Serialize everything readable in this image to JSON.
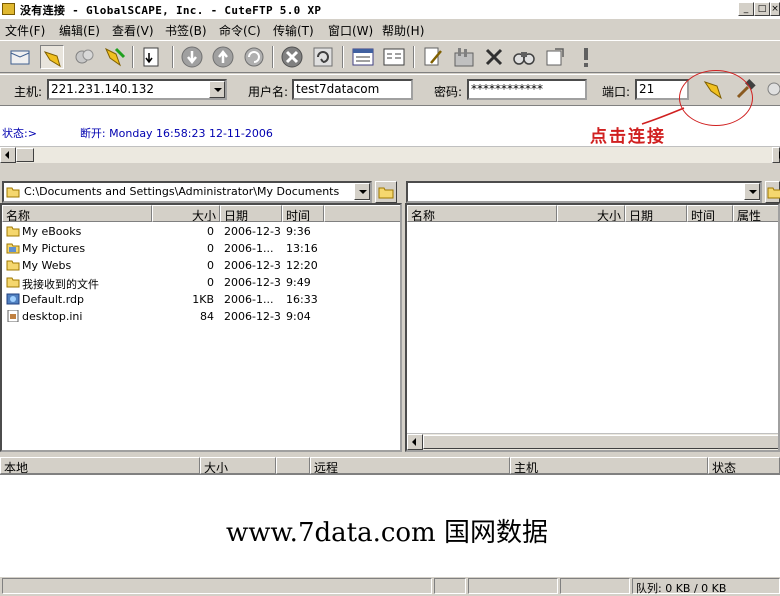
{
  "window": {
    "title": "没有连接 - GlobalSCAPE, Inc. - CuteFTP 5.0 XP",
    "minimize_glyph": "_",
    "maximize_glyph": "□",
    "close_glyph": "×"
  },
  "menu": [
    "文件(F)",
    "编辑(E)",
    "查看(V)",
    "书签(B)",
    "命令(C)",
    "传输(T)",
    "窗口(W)",
    "帮助(H)"
  ],
  "toolbar": {
    "icons": [
      "site-manager-icon",
      "quick-connect-icon",
      "reconnect-icon",
      "disconnect-icon",
      "transfer-icon",
      "download-icon",
      "upload-icon",
      "refresh-remote-icon",
      "stop-icon",
      "refresh-icon",
      "view-list-icon",
      "view-detail-icon",
      "edit-icon",
      "properties-icon",
      "delete-icon",
      "binoculars-icon",
      "settings-icon",
      "help-icon"
    ]
  },
  "connect": {
    "host_label": "主机:",
    "host_value": "221.231.140.132",
    "user_label": "用户名:",
    "user_value": "test7datacom",
    "password_label": "密码:",
    "password_value": "************",
    "port_label": "端口:",
    "port_value": "21"
  },
  "log": {
    "status_label": "状态:>",
    "status_message": "断开: Monday 16:58:23 12-11-2006"
  },
  "local": {
    "path": "C:\\Documents and Settings\\Administrator\\My Documents",
    "columns": [
      "名称",
      "大小",
      "日期",
      "时间"
    ],
    "files": [
      {
        "name": "My eBooks",
        "size": "0",
        "date": "2006-12-3",
        "time": "9:36",
        "icon": "folder-icon"
      },
      {
        "name": "My Pictures",
        "size": "0",
        "date": "2006-1...",
        "time": "13:16",
        "icon": "pictures-folder-icon"
      },
      {
        "name": "My Webs",
        "size": "0",
        "date": "2006-12-3",
        "time": "12:20",
        "icon": "folder-icon"
      },
      {
        "name": "我接收到的文件",
        "size": "0",
        "date": "2006-12-3",
        "time": "9:49",
        "icon": "folder-icon"
      },
      {
        "name": "Default.rdp",
        "size": "1KB",
        "date": "2006-1...",
        "time": "16:33",
        "icon": "rdp-file-icon"
      },
      {
        "name": "desktop.ini",
        "size": "84",
        "date": "2006-12-3",
        "time": "9:04",
        "icon": "ini-file-icon"
      }
    ]
  },
  "remote": {
    "path": "",
    "columns": [
      "名称",
      "大小",
      "日期",
      "时间",
      "属性"
    ]
  },
  "queue": {
    "columns": [
      "本地",
      "大小",
      "远程",
      "主机",
      "状态"
    ]
  },
  "watermark": "www.7data.com  国网数据",
  "statusbar": {
    "queue_text": "队列: 0 KB / 0 KB"
  },
  "annotation": {
    "text": "点击连接",
    "color": "#d02020"
  }
}
